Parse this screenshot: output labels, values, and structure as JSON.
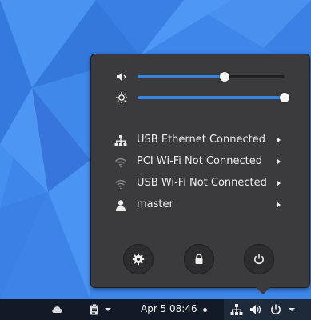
{
  "colors": {
    "wallpaper_base": "#3f86ea",
    "menu_bg": "#3b3b3d",
    "accent": "#3584e4",
    "panel_bg": "#111a26",
    "text": "#eeeeec"
  },
  "sliders": [
    {
      "icon": "volume-icon",
      "value": 0.59
    },
    {
      "icon": "brightness-icon",
      "value": 1.0
    }
  ],
  "menu_items": [
    {
      "icon": "ethernet-icon",
      "label": "USB Ethernet Connected"
    },
    {
      "icon": "wifi-icon",
      "label": "PCI Wi-Fi Not Connected"
    },
    {
      "icon": "wifi-icon",
      "label": "USB Wi-Fi Not Connected"
    },
    {
      "icon": "user-icon",
      "label": "master"
    }
  ],
  "action_buttons": [
    {
      "icon": "settings-icon"
    },
    {
      "icon": "lock-icon"
    },
    {
      "icon": "power-icon"
    }
  ],
  "top_bar": {
    "clock": "Apr 5  08:46",
    "indicators": [
      "cloud-icon",
      "clipboard-icon",
      "network-wired-icon",
      "volume-icon",
      "power-icon"
    ]
  }
}
